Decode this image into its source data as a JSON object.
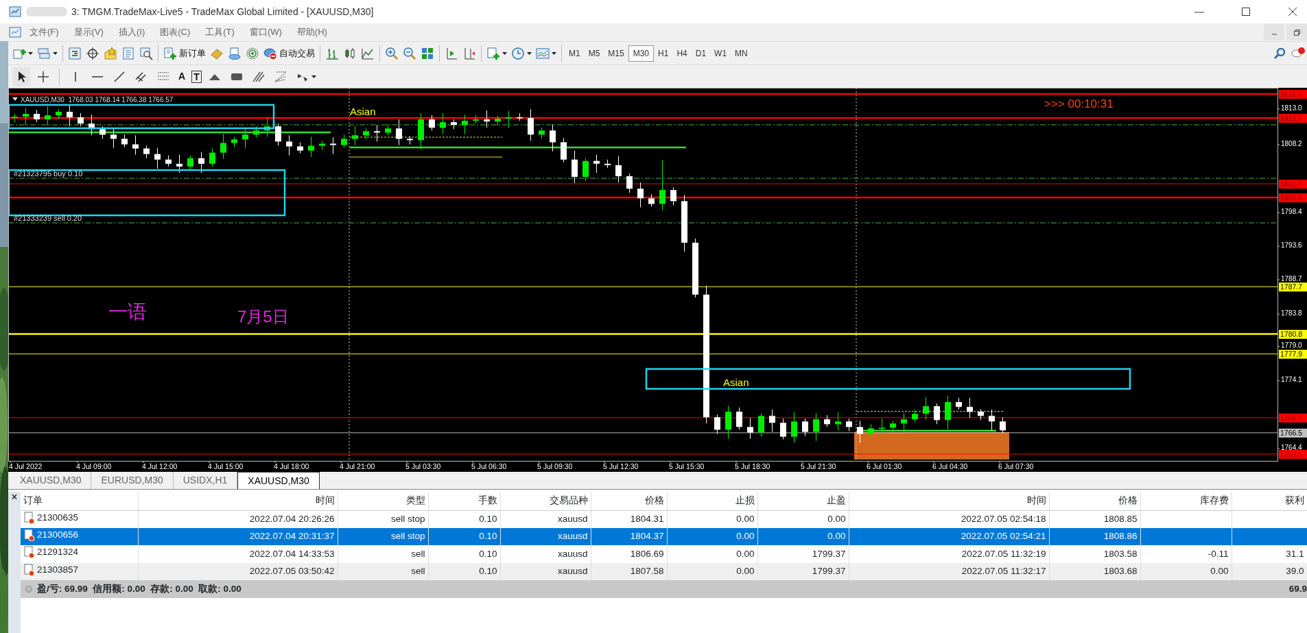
{
  "window": {
    "title": "3: TMGM.TradeMax-Live5 - TradeMax Global Limited - [XAUUSD,M30]"
  },
  "menu": [
    "文件(F)",
    "显示(V)",
    "插入(I)",
    "图表(C)",
    "工具(T)",
    "窗口(W)",
    "帮助(H)"
  ],
  "toolbar": {
    "new_order": "新订单",
    "auto_trading": "自动交易",
    "timeframes": [
      {
        "label": "M1",
        "selected": false
      },
      {
        "label": "M5",
        "selected": false
      },
      {
        "label": "M15",
        "selected": false
      },
      {
        "label": "M30",
        "selected": true
      },
      {
        "label": "H1",
        "selected": false
      },
      {
        "label": "H4",
        "selected": false
      },
      {
        "label": "D1",
        "selected": false
      },
      {
        "label": "W1",
        "selected": false
      },
      {
        "label": "MN",
        "selected": false
      }
    ],
    "text_tools": [
      "A",
      "T"
    ]
  },
  "chart": {
    "symbol_info": "XAUUSD,M30  1768.03 1768.14 1766.38 1766.57",
    "countdown": ">>> 00:10:31",
    "order_labels": [
      "#21323795 buy 0.10",
      "#21333239 sell 0.20"
    ],
    "session_labels": [
      "Asian",
      "Asian"
    ],
    "notes": [
      "一语",
      "7月5日"
    ],
    "levels": [
      {
        "price": "1815.5",
        "color": "#ff0000",
        "thick": true
      },
      {
        "price": "1812.7",
        "color": "#ff0000",
        "thick": true
      },
      {
        "price": "1802.7",
        "color": "#ff0000",
        "thick": false
      },
      {
        "price": "1800.6",
        "color": "#ff0000",
        "thick": true
      },
      {
        "price": "1787.7",
        "color": "#ffff00",
        "thick": false
      },
      {
        "price": "1780.8",
        "color": "#ffff00",
        "thick": true
      },
      {
        "price": "1777.9",
        "color": "#ffff00",
        "thick": false
      },
      {
        "price": "1768.7",
        "color": "#ff0000",
        "thick": false
      },
      {
        "price": "1766.5",
        "color": "#c0c0c0",
        "thick": false
      },
      {
        "price": "1763.5",
        "color": "#ff0000",
        "thick": false
      }
    ],
    "price_ticks": [
      "1813.0",
      "1808.2",
      "1798.4",
      "1793.6",
      "1788.7",
      "1783.8",
      "1779.0",
      "1774.1",
      "1764.4"
    ],
    "time_ticks": [
      "4 Jul 2022",
      "4 Jul 09:00",
      "4 Jul 12:00",
      "4 Jul 15:00",
      "4 Jul 18:00",
      "4 Jul 21:00",
      "5 Jul 03:30",
      "5 Jul 06:30",
      "5 Jul 09:30",
      "5 Jul 12:30",
      "5 Jul 15:30",
      "5 Jul 18:30",
      "5 Jul 21:30",
      "6 Jul 01:30",
      "6 Jul 04:30",
      "6 Jul 07:30"
    ]
  },
  "chart_tabs": [
    {
      "label": "XAUUSD,M30",
      "selected": false
    },
    {
      "label": "EURUSD,M30",
      "selected": false
    },
    {
      "label": "USIDX,H1",
      "selected": false
    },
    {
      "label": "XAUUSD,M30",
      "selected": true
    }
  ],
  "terminal": {
    "close": "×",
    "columns": [
      "订单",
      "时间",
      "类型",
      "手数",
      "交易品种",
      "价格",
      "止损",
      "止盈",
      "时间",
      "价格",
      "库存费",
      "获利"
    ],
    "rows": [
      {
        "selected": false,
        "cells": [
          "21300635",
          "2022.07.04 20:26:26",
          "sell stop",
          "0.10",
          "xauusd",
          "1804.31",
          "0.00",
          "0.00",
          "2022.07.05 02:54:18",
          "1808.85",
          "",
          ""
        ]
      },
      {
        "selected": true,
        "cells": [
          "21300656",
          "2022.07.04 20:31:37",
          "sell stop",
          "0.10",
          "xauusd",
          "1804.37",
          "0.00",
          "0.00",
          "2022.07.05 02:54:21",
          "1808.86",
          "",
          ""
        ]
      },
      {
        "selected": false,
        "cells": [
          "21291324",
          "2022.07.04 14:33:53",
          "sell",
          "0.10",
          "xauusd",
          "1806.69",
          "0.00",
          "1799.37",
          "2022.07.05 11:32:19",
          "1803.58",
          "-0.11",
          "31.1"
        ]
      },
      {
        "selected": false,
        "cells": [
          "21303857",
          "2022.07.05 03:50:42",
          "sell",
          "0.10",
          "xauusd",
          "1807.58",
          "0.00",
          "1799.37",
          "2022.07.05 11:32:17",
          "1803.68",
          "0.00",
          "39.0"
        ]
      }
    ],
    "summary": "盈/亏: 69.99  信用额: 0.00  存款: 0.00  取款: 0.00",
    "summary_profit": "69.9"
  }
}
